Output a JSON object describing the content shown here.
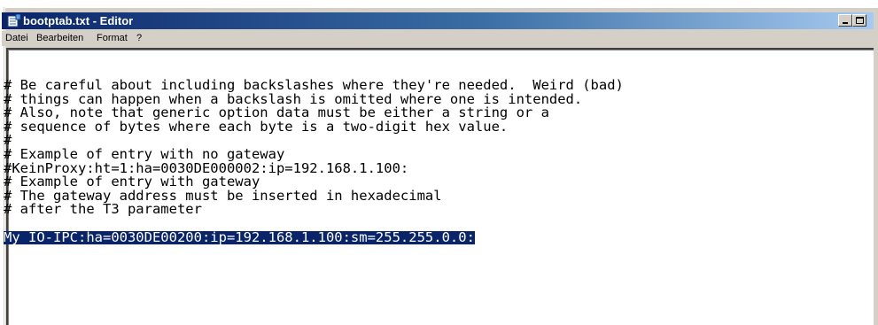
{
  "window": {
    "title": "bootptab.txt - Editor",
    "icon": "notepad-icon"
  },
  "menu": [
    {
      "label": "Datei"
    },
    {
      "label": "Bearbeiten"
    },
    {
      "label": "Format"
    },
    {
      "label": "?"
    }
  ],
  "editor": {
    "lines": [
      "# Be careful about including backslashes where they're needed.  Weird (bad)",
      "# things can happen when a backslash is omitted where one is intended.",
      "# Also, note that generic option data must be either a string or a",
      "# sequence of bytes where each byte is a two-digit hex value.",
      "#",
      "# Example of entry with no gateway",
      "#KeinProxy:ht=1:ha=0030DE000002:ip=192.168.1.100:",
      "# Example of entry with gateway",
      "# The gateway address must be inserted in hexadecimal",
      "# after the T3 parameter",
      "",
      "My_IO-IPC:ha=0030DE00200:ip=192.168.1.100:sm=255.255.0.0:"
    ],
    "selected_line": "My_IO-IPC:ha=0030DE00200:ip=192.168.1.100:sm=255.255.0.0:"
  },
  "colors": {
    "selection_bg": "#0a246a",
    "titlebar_start": "#0a246a",
    "titlebar_end": "#a6caf0"
  }
}
